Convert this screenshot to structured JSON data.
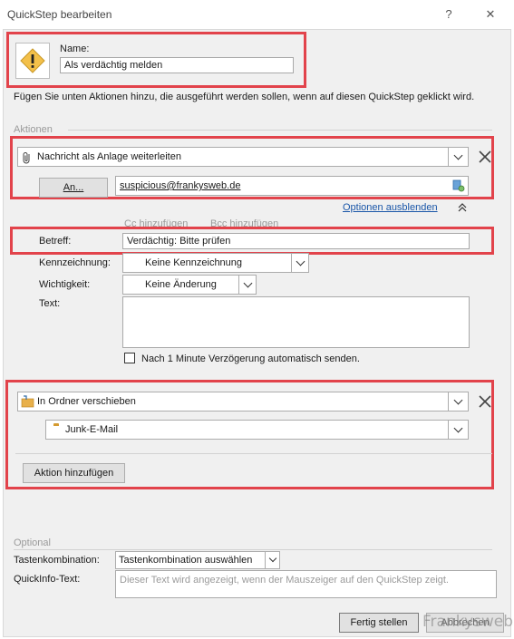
{
  "window": {
    "title": "QuickStep bearbeiten",
    "help": "?",
    "close": "✕"
  },
  "name": {
    "label": "Name:",
    "value": "Als verdächtig melden"
  },
  "instructions": "Fügen Sie unten Aktionen hinzu, die ausgeführt werden sollen, wenn auf diesen QuickStep geklickt wird.",
  "actions_section": "Aktionen",
  "action1": {
    "select": "Nachricht als Anlage weiterleiten",
    "to_button": "An...",
    "to_value": "suspicious@frankysweb.de",
    "hide_options": "Optionen ausblenden",
    "cc_link": "Cc hinzufügen",
    "bcc_link": "Bcc hinzufügen",
    "subject_label": "Betreff:",
    "subject_value": "Verdächtig: Bitte prüfen",
    "flag_label": "Kennzeichnung:",
    "flag_value": "Keine Kennzeichnung",
    "importance_label": "Wichtigkeit:",
    "importance_value": "Keine Änderung",
    "text_label": "Text:",
    "text_value": "",
    "autosend_label": "Nach 1 Minute Verzögerung automatisch senden."
  },
  "action2": {
    "select": "In Ordner verschieben",
    "folder": "Junk-E-Mail"
  },
  "add_action_button": "Aktion hinzufügen",
  "optional": {
    "section": "Optional",
    "shortcut_label": "Tastenkombination:",
    "shortcut_value": "Tastenkombination auswählen",
    "tooltip_label": "QuickInfo-Text:",
    "tooltip_value": "Dieser Text wird angezeigt, wenn der Mauszeiger auf den QuickStep zeigt."
  },
  "footer": {
    "finish_button": "Fertig stellen",
    "cancel_button": "Abbrechen"
  },
  "watermark": "Frankysweb",
  "colors": {
    "highlight_box": "#e2434b",
    "link": "#1a56a8",
    "folder": "#e8b04a"
  }
}
